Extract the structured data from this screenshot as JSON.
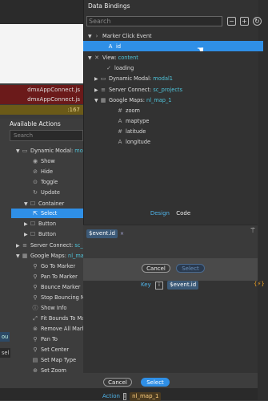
{
  "background": {
    "rows": [
      "dmxAppConnect.js",
      "dmxAppConnect.js",
      ":167"
    ],
    "side_labels": [
      "ou",
      "sel"
    ]
  },
  "available_actions": {
    "title": "Available Actions",
    "search_placeholder": "Search",
    "items": [
      {
        "label": "Dynamic Modal:",
        "suffix": "modal1"
      },
      {
        "label": "Show"
      },
      {
        "label": "Hide"
      },
      {
        "label": "Toggle"
      },
      {
        "label": "Update"
      },
      {
        "label": "Container"
      },
      {
        "label": "Select"
      },
      {
        "label": "Button"
      },
      {
        "label": "Button"
      },
      {
        "label": "Server Connect:",
        "suffix": "sc_projects"
      },
      {
        "label": "Google Maps:",
        "suffix": "nl_map_1"
      },
      {
        "label": "Go To Marker"
      },
      {
        "label": "Pan To Marker"
      },
      {
        "label": "Bounce Marker"
      },
      {
        "label": "Stop Bouncing Marker"
      },
      {
        "label": "Show Info"
      },
      {
        "label": "Fit Bounds To Markers"
      },
      {
        "label": "Remove All Markers"
      },
      {
        "label": "Pan To"
      },
      {
        "label": "Set Center"
      },
      {
        "label": "Set Map Type"
      },
      {
        "label": "Set Zoom"
      }
    ],
    "cancel": "Cancel",
    "select": "Select"
  },
  "data_bindings": {
    "title": "Data Bindings",
    "search_placeholder": "Search",
    "tree": [
      {
        "label": "Marker Click Event"
      },
      {
        "label": "id"
      },
      {
        "label": "View:",
        "suffix": "content"
      },
      {
        "label": "loading"
      },
      {
        "label": "Dynamic Modal:",
        "suffix": "modal1"
      },
      {
        "label": "Server Connect:",
        "suffix": "sc_projects"
      },
      {
        "label": "Google Maps:",
        "suffix": "nl_map_1"
      },
      {
        "label": "zoom"
      },
      {
        "label": "maptype"
      },
      {
        "label": "latitude"
      },
      {
        "label": "longitude"
      }
    ],
    "tab_design": "Design",
    "tab_code": "Code",
    "expression": "$event.id",
    "cancel": "Cancel",
    "select": "Select"
  },
  "behind": {
    "key_label": "Key",
    "key_value": "$event.id",
    "action_label": "Action",
    "action_value": "nl_map_1"
  },
  "colors": {
    "accent": "#2f8fe6",
    "teal": "#4fc3d9"
  }
}
